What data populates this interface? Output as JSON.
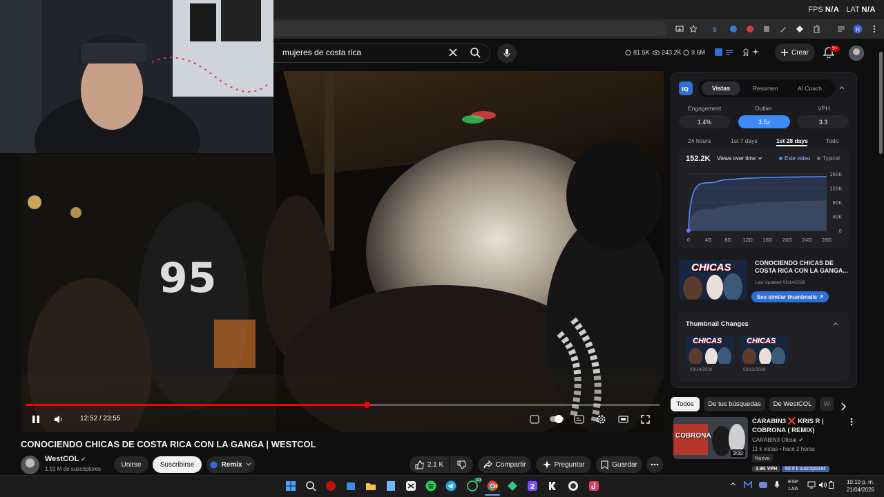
{
  "overlay": {
    "fps_label": "FPS",
    "fps_value": "N/A",
    "lat_label": "LAT",
    "lat_value": "N/A"
  },
  "header": {
    "search_value": "mujeres de costa rica",
    "stats": [
      "81.5K",
      "243.2K",
      "9.6M"
    ],
    "create_label": "Crear",
    "notifications_badge": "9+"
  },
  "player": {
    "time_current": "12:52",
    "time_separator": "/",
    "time_total": "23:55",
    "progress_fraction": 0.538
  },
  "video": {
    "title": "CONOCIENDO CHICAS DE COSTA RICA CON LA GANGA | WESTCOL",
    "channel_name": "WestCOL",
    "channel_subs": "1.91 M de suscriptores",
    "join_label": "Unirse",
    "subscribe_label": "Suscribirse",
    "remix_label": "Remix",
    "likes": "2.1 K",
    "share_label": "Compartir",
    "ask_label": "Preguntar",
    "save_label": "Guardar"
  },
  "iq_panel": {
    "tabs": [
      "Vistas",
      "Resumen",
      "AI Coach"
    ],
    "metrics": [
      {
        "label": "Engagement",
        "value": "1.4%"
      },
      {
        "label": "Outlier",
        "value": "3.5x"
      },
      {
        "label": "VPH",
        "value": "3.3"
      }
    ],
    "periods": [
      "24 hours",
      "1st 7 days",
      "1st 28 days",
      "Todo"
    ],
    "views_total": "152.2K",
    "views_mode": "Views over time",
    "legend_this": "Este video",
    "legend_typical": "Typical",
    "video_card_title": "CONOCIENDO CHICAS DE COSTA RICA CON LA GANGA...",
    "last_updated": "Last Updated 03/14/2026",
    "similar_label": "See similar thumbnails",
    "thumb_changes_title": "Thumbnail Changes",
    "thumb_dates": [
      "03/14/2026",
      "03/13/2026"
    ],
    "thumb_text": "CHICAS"
  },
  "chart_data": {
    "type": "area",
    "x": [
      "0",
      "4D",
      "8D",
      "12D",
      "16D",
      "20D",
      "24D",
      "28D"
    ],
    "y_ticks": [
      "160K",
      "120K",
      "80K",
      "40K",
      "0"
    ],
    "ylim": [
      0,
      160000
    ],
    "series": [
      {
        "name": "Este video",
        "values": [
          0,
          135000,
          144000,
          148000,
          150000,
          151000,
          151800,
          152200
        ]
      },
      {
        "values": [
          0,
          60000,
          70000,
          76000,
          80000,
          82000,
          84000,
          85000
        ]
      }
    ],
    "colors": {
      "this": "#4e8cff",
      "typical": "#555a66"
    }
  },
  "filters": [
    "Todos",
    "De tus búsquedas",
    "De WestCOL",
    "W"
  ],
  "recommendation": {
    "title": "CARABIN3 ❌ KRIS R | COBRONA ( REMIX)",
    "channel": "CARABIN3 Oficial",
    "meta": "11 k vistas • hace 2 horas",
    "badge": "Nuevo",
    "duration": "3:32",
    "vph": "3.9K VPH",
    "subs": "60.9 k suscriptores",
    "thumb_text": "COBRONA"
  },
  "taskbar": {
    "lang_top": "ESP",
    "lang_bottom": "LAA",
    "time": "10:10 p. m.",
    "date": "21/04/2026",
    "whatsapp_badge": "10"
  }
}
